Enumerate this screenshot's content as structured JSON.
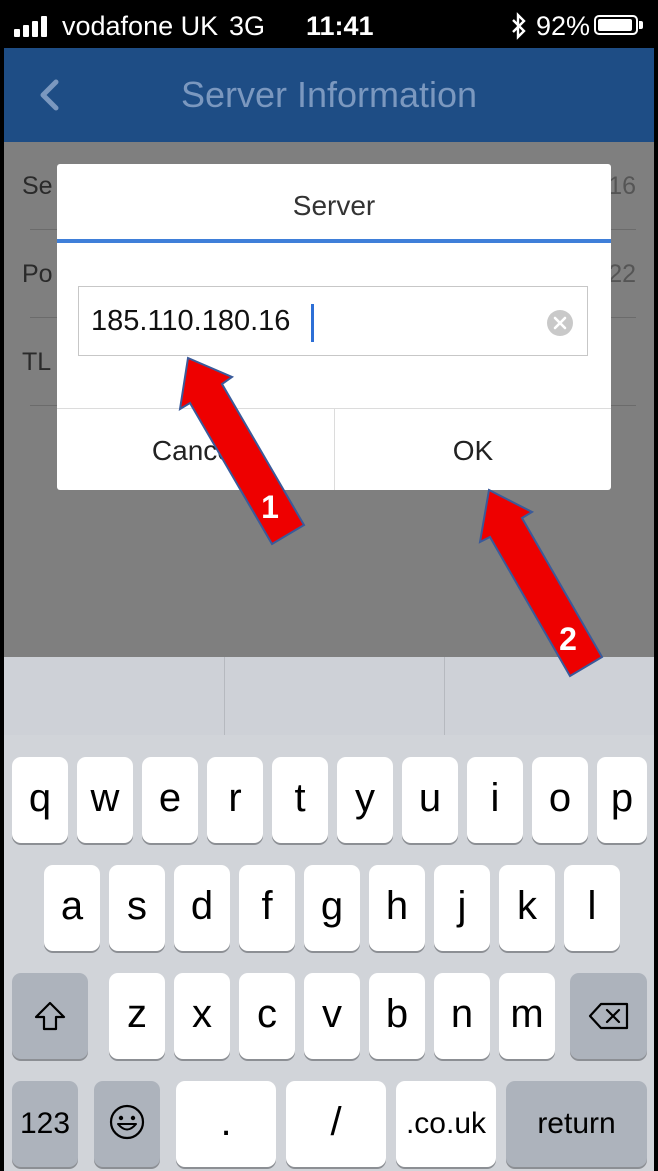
{
  "status_bar": {
    "carrier": "vodafone UK",
    "network": "3G",
    "time": "11:41",
    "bluetooth_icon": "bluetooth-icon",
    "battery_percent": "92%",
    "battery_level": 0.92
  },
  "nav": {
    "back_icon": "chevron-left-icon",
    "title": "Server Information"
  },
  "list": {
    "rows": [
      {
        "label": "Se",
        "value": "16"
      },
      {
        "label": "Po",
        "value": "22"
      },
      {
        "label": "TL",
        "value": ""
      }
    ]
  },
  "dialog": {
    "title": "Server",
    "input_value": "185.110.180.16",
    "clear_icon": "clear-circle-icon",
    "cancel_label": "Cancel",
    "ok_label": "OK",
    "accent_color": "#3f7fd9"
  },
  "keyboard": {
    "row1": [
      "q",
      "w",
      "e",
      "r",
      "t",
      "y",
      "u",
      "i",
      "o",
      "p"
    ],
    "row2": [
      "a",
      "s",
      "d",
      "f",
      "g",
      "h",
      "j",
      "k",
      "l"
    ],
    "row3": [
      "z",
      "x",
      "c",
      "v",
      "b",
      "n",
      "m"
    ],
    "shift_icon": "shift-icon",
    "backspace_icon": "backspace-icon",
    "emoji_icon": "emoji-icon",
    "numbers_label": "123",
    "dot_label": ".",
    "slash_label": "/",
    "couk_label": ".co.uk",
    "return_label": "return"
  },
  "annotations": {
    "arrow1_number": "1",
    "arrow2_number": "2",
    "arrow_color": "#ee0000"
  }
}
